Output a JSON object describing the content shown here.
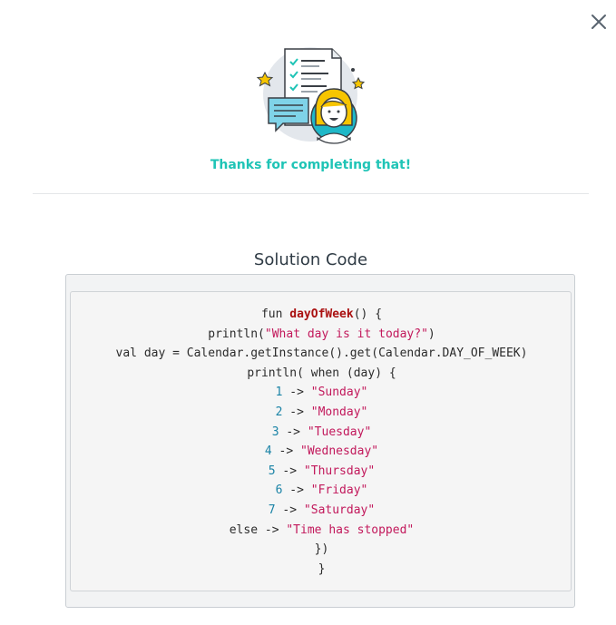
{
  "dialog": {
    "close_label": "close",
    "thanks_message": "Thanks for completing that!",
    "solution_title": "Solution Code"
  },
  "code": {
    "l1": {
      "kw": "fun ",
      "fn": "dayOfWeek",
      "rest": "() {"
    },
    "l2": {
      "pre": "println(",
      "str": "\"What day is it today?\"",
      "post": ")"
    },
    "l3": "val day = Calendar.getInstance().get(Calendar.DAY_OF_WEEK)",
    "l4": "println( when (day) {",
    "cases": [
      {
        "num": "1",
        "arrow": " -> ",
        "str": "\"Sunday\""
      },
      {
        "num": "2",
        "arrow": " -> ",
        "str": "\"Monday\""
      },
      {
        "num": "3",
        "arrow": " -> ",
        "str": "\"Tuesday\""
      },
      {
        "num": "4",
        "arrow": " -> ",
        "str": "\"Wednesday\""
      },
      {
        "num": "5",
        "arrow": " -> ",
        "str": "\"Thursday\""
      },
      {
        "num": "6",
        "arrow": " -> ",
        "str": "\"Friday\""
      },
      {
        "num": "7",
        "arrow": " -> ",
        "str": "\"Saturday\""
      }
    ],
    "else_line": {
      "pre": "else -> ",
      "str": "\"Time has stopped\""
    },
    "close1": "})",
    "close2": "}"
  },
  "colors": {
    "accent": "#1fc4b6",
    "string": "#c2185b",
    "number": "#1a83a6",
    "function": "#aa1111"
  }
}
